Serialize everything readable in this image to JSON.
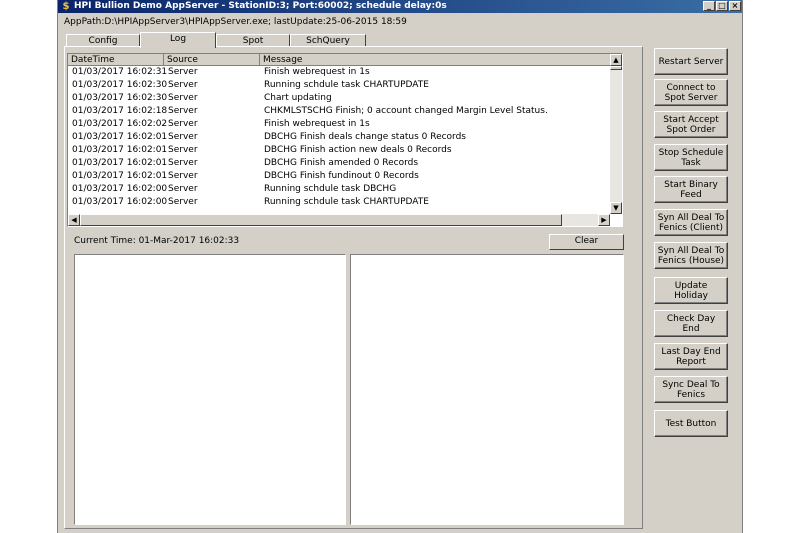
{
  "window": {
    "title": "HPI Bullion Demo AppServer - StationID:3; Port:60002; schedule delay:0s",
    "min": "_",
    "max": "□",
    "close": "×"
  },
  "apppath": "AppPath:D:\\HPIAppServer3\\HPIAppServer.exe; lastUpdate:25-06-2015 18:59",
  "tabs": [
    {
      "label": "Config"
    },
    {
      "label": "Log"
    },
    {
      "label": "Spot"
    },
    {
      "label": "SchQuery"
    }
  ],
  "log": {
    "columns": [
      "DateTime",
      "Source",
      "Message"
    ],
    "rows": [
      [
        "01/03/2017 16:02:31",
        "Server",
        "Finish webrequest in 1s"
      ],
      [
        "01/03/2017 16:02:30",
        "Server",
        "Running schdule task CHARTUPDATE"
      ],
      [
        "01/03/2017 16:02:30",
        "Server",
        "Chart updating"
      ],
      [
        "01/03/2017 16:02:18",
        "Server",
        "CHKMLSTSCHG Finish; 0 account changed Margin Level Status."
      ],
      [
        "01/03/2017 16:02:02",
        "Server",
        "Finish webrequest in 1s"
      ],
      [
        "01/03/2017 16:02:01",
        "Server",
        "DBCHG Finish deals change status 0 Records"
      ],
      [
        "01/03/2017 16:02:01",
        "Server",
        "DBCHG Finish action new deals 0 Records"
      ],
      [
        "01/03/2017 16:02:01",
        "Server",
        "DBCHG Finish amended 0 Records"
      ],
      [
        "01/03/2017 16:02:01",
        "Server",
        "DBCHG Finish fundinout 0 Records"
      ],
      [
        "01/03/2017 16:02:00",
        "Server",
        "Running schdule task DBCHG"
      ],
      [
        "01/03/2017 16:02:00",
        "Server",
        "Running schdule task CHARTUPDATE"
      ]
    ]
  },
  "current_time": "Current Time: 01-Mar-2017 16:02:33",
  "clear_label": "Clear",
  "buttons": [
    {
      "label": "Restart Server"
    },
    {
      "label": "Connect to Spot Server"
    },
    {
      "label": "Start Accept Spot Order"
    },
    {
      "label": "Stop Schedule Task"
    },
    {
      "label": "Start Binary Feed"
    },
    {
      "label": "Syn All Deal To Fenics (Client)"
    },
    {
      "label": "Syn All Deal To Fenics (House)"
    },
    {
      "label": "Update Holiday"
    },
    {
      "label": "Check Day End"
    },
    {
      "label": "Last Day End Report"
    },
    {
      "label": "Sync Deal To Fenics"
    },
    {
      "label": "Test Button"
    }
  ]
}
